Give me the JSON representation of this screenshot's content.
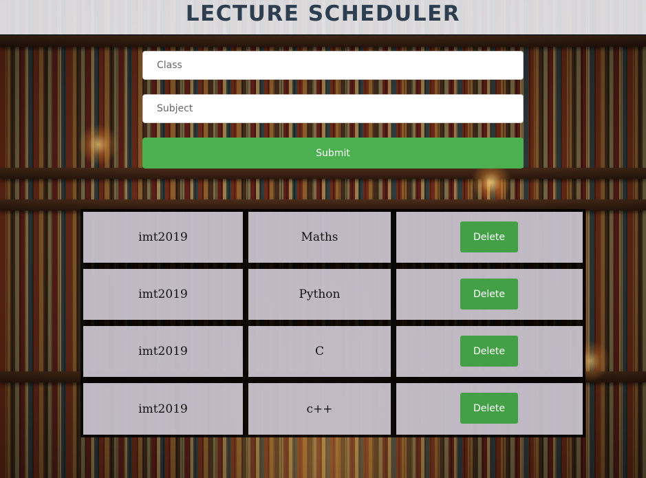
{
  "header": {
    "title": "LECTURE SCHEDULER"
  },
  "form": {
    "class_placeholder": "Class",
    "class_value": "",
    "subject_placeholder": "Subject",
    "subject_value": "",
    "submit_label": "Submit"
  },
  "lectures": [
    {
      "class": "imt2019",
      "subject": "Maths",
      "delete_label": "Delete"
    },
    {
      "class": "imt2019",
      "subject": "Python",
      "delete_label": "Delete"
    },
    {
      "class": "imt2019",
      "subject": "C",
      "delete_label": "Delete"
    },
    {
      "class": "imt2019",
      "subject": "c++",
      "delete_label": "Delete"
    }
  ],
  "colors": {
    "button_green": "#4caf50",
    "title_color": "#2c3e50",
    "header_bg": "#ebebf0",
    "row_bg": "#e8e1ee"
  }
}
